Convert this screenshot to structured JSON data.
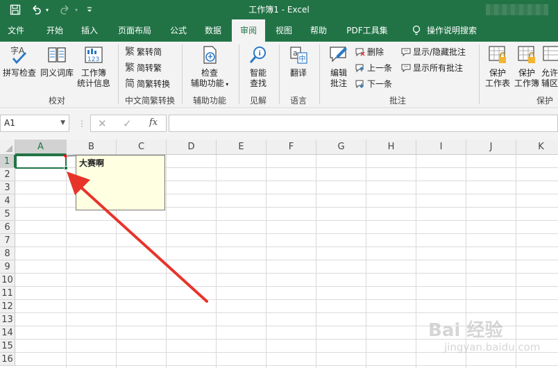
{
  "app": {
    "title": "工作簿1  -  Excel"
  },
  "colors": {
    "brand": "#217346",
    "comment_bg": "#ffffe1",
    "arrow": "#e8332a"
  },
  "quick_access": [
    "save-icon",
    "undo-icon",
    "redo-icon",
    "customize-icon"
  ],
  "tabs": [
    {
      "label": "文件"
    },
    {
      "label": "开始"
    },
    {
      "label": "插入"
    },
    {
      "label": "页面布局"
    },
    {
      "label": "公式"
    },
    {
      "label": "数据"
    },
    {
      "label": "审阅",
      "active": true
    },
    {
      "label": "视图"
    },
    {
      "label": "帮助"
    },
    {
      "label": "PDF工具集"
    }
  ],
  "tell_me": "操作说明搜索",
  "ribbon": {
    "proofing": {
      "spell": "拼写检查",
      "thesaurus": "同义词库",
      "stats_1": "工作簿",
      "stats_2": "统计信息",
      "group": "校对"
    },
    "chinese": {
      "to_trad": "繁转简",
      "to_simp": "简转繁",
      "convert": "简繁转换",
      "group": "中文简繁转换"
    },
    "access": {
      "check_1": "检查",
      "check_2": "辅助功能",
      "group": "辅助功能"
    },
    "insights": {
      "smart_1": "智能",
      "smart_2": "查找",
      "group": "见解"
    },
    "language": {
      "translate": "翻译",
      "group": "语言"
    },
    "comments": {
      "edit_1": "编辑",
      "edit_2": "批注",
      "delete": "删除",
      "prev": "上一条",
      "next": "下一条",
      "show_hide": "显示/隐藏批注",
      "show_all": "显示所有批注",
      "group": "批注"
    },
    "protect": {
      "sheet_1": "保护",
      "sheet_2": "工作表",
      "book_1": "保护",
      "book_2": "工作簿",
      "range_1": "允许",
      "range_2": "辅区",
      "group": "保护"
    }
  },
  "formula_bar": {
    "name_box": "A1",
    "fx": "fx",
    "value": ""
  },
  "grid": {
    "columns": [
      "A",
      "B",
      "C",
      "D",
      "E",
      "F",
      "G",
      "H",
      "I",
      "J",
      "K"
    ],
    "rows": [
      "1",
      "2",
      "3",
      "4",
      "5",
      "6",
      "7",
      "8",
      "9",
      "10",
      "11",
      "12",
      "13",
      "14",
      "15",
      "16"
    ],
    "selected_cell": "A1",
    "comment_text": "大赛啊"
  },
  "watermark": {
    "main": "Bai 经验",
    "sub": "jingyan.baidu.com"
  }
}
